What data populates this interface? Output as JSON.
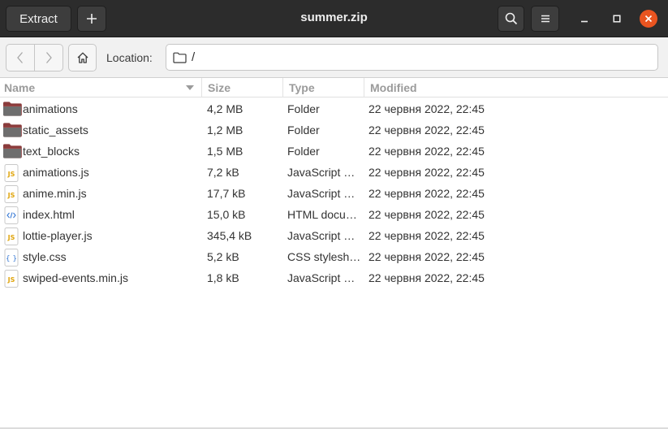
{
  "window": {
    "title": "summer.zip",
    "extract_label": "Extract"
  },
  "location": {
    "label": "Location:",
    "path": "/"
  },
  "columns": {
    "name": "Name",
    "size": "Size",
    "type": "Type",
    "modified": "Modified"
  },
  "files": [
    {
      "icon": "folder-icon",
      "name": "animations",
      "size": "4,2 MB",
      "type": "Folder",
      "modified": "22 червня 2022, 22:45"
    },
    {
      "icon": "folder-icon",
      "name": "static_assets",
      "size": "1,2 MB",
      "type": "Folder",
      "modified": "22 червня 2022, 22:45"
    },
    {
      "icon": "folder-icon",
      "name": "text_blocks",
      "size": "1,5 MB",
      "type": "Folder",
      "modified": "22 червня 2022, 22:45"
    },
    {
      "icon": "javascript-file-icon",
      "name": "animations.js",
      "size": "7,2 kB",
      "type": "JavaScript …",
      "modified": "22 червня 2022, 22:45"
    },
    {
      "icon": "javascript-file-icon",
      "name": "anime.min.js",
      "size": "17,7 kB",
      "type": "JavaScript …",
      "modified": "22 червня 2022, 22:45"
    },
    {
      "icon": "html-file-icon",
      "name": "index.html",
      "size": "15,0 kB",
      "type": "HTML docu…",
      "modified": "22 червня 2022, 22:45"
    },
    {
      "icon": "javascript-file-icon",
      "name": "lottie-player.js",
      "size": "345,4 kB",
      "type": "JavaScript …",
      "modified": "22 червня 2022, 22:45"
    },
    {
      "icon": "css-file-icon",
      "name": "style.css",
      "size": "5,2 kB",
      "type": "CSS stylesh…",
      "modified": "22 червня 2022, 22:45"
    },
    {
      "icon": "javascript-file-icon",
      "name": "swiped-events.min.js",
      "size": "1,8 kB",
      "type": "JavaScript …",
      "modified": "22 червня 2022, 22:45"
    }
  ],
  "colors": {
    "headerbar": "#2c2c2c",
    "close_button": "#e95420",
    "folder": "#8a3b3b",
    "js_badge": "#e0a50e",
    "html_badge": "#3b7bd4"
  }
}
